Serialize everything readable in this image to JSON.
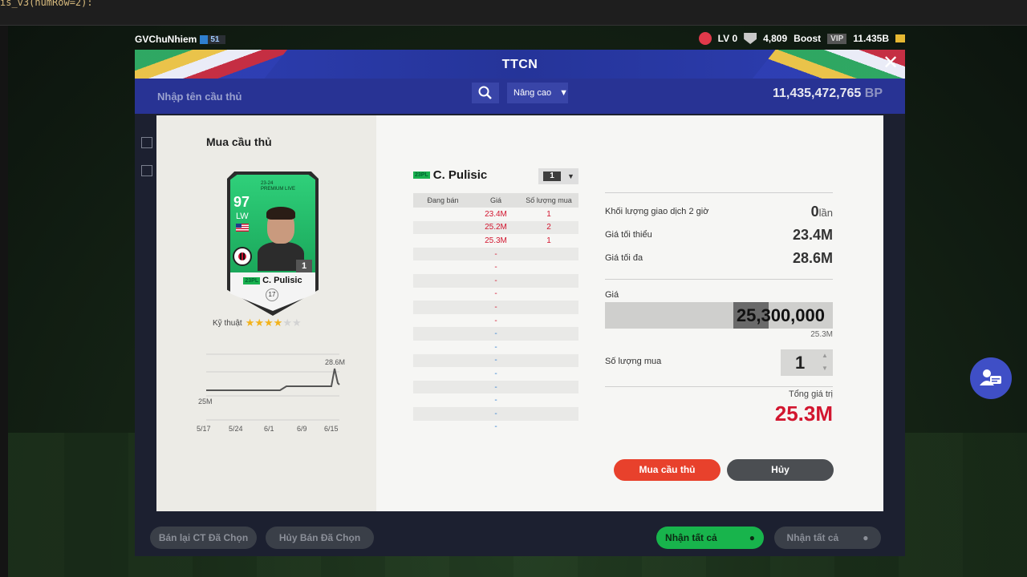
{
  "editor": {
    "code_text": "is_v3(numRow=2):"
  },
  "topbar": {
    "username": "GVChuNhiem",
    "user_badge": "51",
    "lv": "LV 0",
    "points": "4,809",
    "boost": "Boost",
    "vip": "VIP",
    "balance": "11.435B"
  },
  "outer": {
    "title": "TTCN",
    "search_placeholder": "Nhập tên cầu thủ",
    "advanced_label": "Nâng cao",
    "bp_amount": "11,435,472,765",
    "bp_unit": "BP",
    "bottom_buttons": [
      "Bán lại CT Đã Chọn",
      "Hủy Bán Đã Chọn",
      "Nhận tất cả",
      "Nhận tất cả"
    ]
  },
  "dialog": {
    "title": "Mua cầu thủ",
    "card": {
      "ovr": "97",
      "position": "LW",
      "season_line1": "23-24",
      "season_line2": "PREMIUM LIVE",
      "season_tag": "23PL",
      "name": "C. Pulisic",
      "level": "1",
      "number": "17"
    },
    "skill_label": "Kỹ thuật",
    "skill_stars": 4,
    "skill_max": 6,
    "price_history": {
      "max_label": "28.6M",
      "min_label": "25M",
      "dates": [
        "5/17",
        "5/24",
        "6/1",
        "6/9",
        "6/15"
      ]
    },
    "player_name": "C. Pulisic",
    "season_tag": "23PL",
    "level_select": "1",
    "table": {
      "headers": [
        "Đang bán",
        "Giá",
        "Số lượng mua"
      ],
      "rows": [
        {
          "price": "23.4M",
          "qty": "1"
        },
        {
          "price": "25.2M",
          "qty": "2"
        },
        {
          "price": "25.3M",
          "qty": "1"
        },
        {
          "price": "-",
          "qty": ""
        },
        {
          "price": "-",
          "qty": ""
        },
        {
          "price": "-",
          "qty": ""
        },
        {
          "price": "-",
          "qty": ""
        },
        {
          "price": "-",
          "qty": ""
        },
        {
          "price": "-",
          "qty": ""
        },
        {
          "price": "-",
          "qty": ""
        },
        {
          "price": "-",
          "qty": ""
        },
        {
          "price": "-",
          "qty": ""
        },
        {
          "price": "-",
          "qty": ""
        },
        {
          "price": "-",
          "qty": ""
        },
        {
          "price": "-",
          "qty": ""
        },
        {
          "price": "-",
          "qty": ""
        },
        {
          "price": "-",
          "qty": ""
        }
      ]
    },
    "stats": {
      "volume_label": "Khối lượng giao dịch 2 giờ",
      "volume_value": "0",
      "volume_unit": "lần",
      "min_label": "Giá tối thiểu",
      "min_value": "23.4M",
      "max_label": "Giá tối đa",
      "max_value": "28.6M"
    },
    "price_label": "Giá",
    "price_value": "25,300,000",
    "price_short": "25.3M",
    "qty_label": "Số lượng mua",
    "qty_value": "1",
    "total_label": "Tổng giá trị",
    "total_value": "25.3M",
    "buy_label": "Mua cầu thủ",
    "cancel_label": "Hủy"
  }
}
